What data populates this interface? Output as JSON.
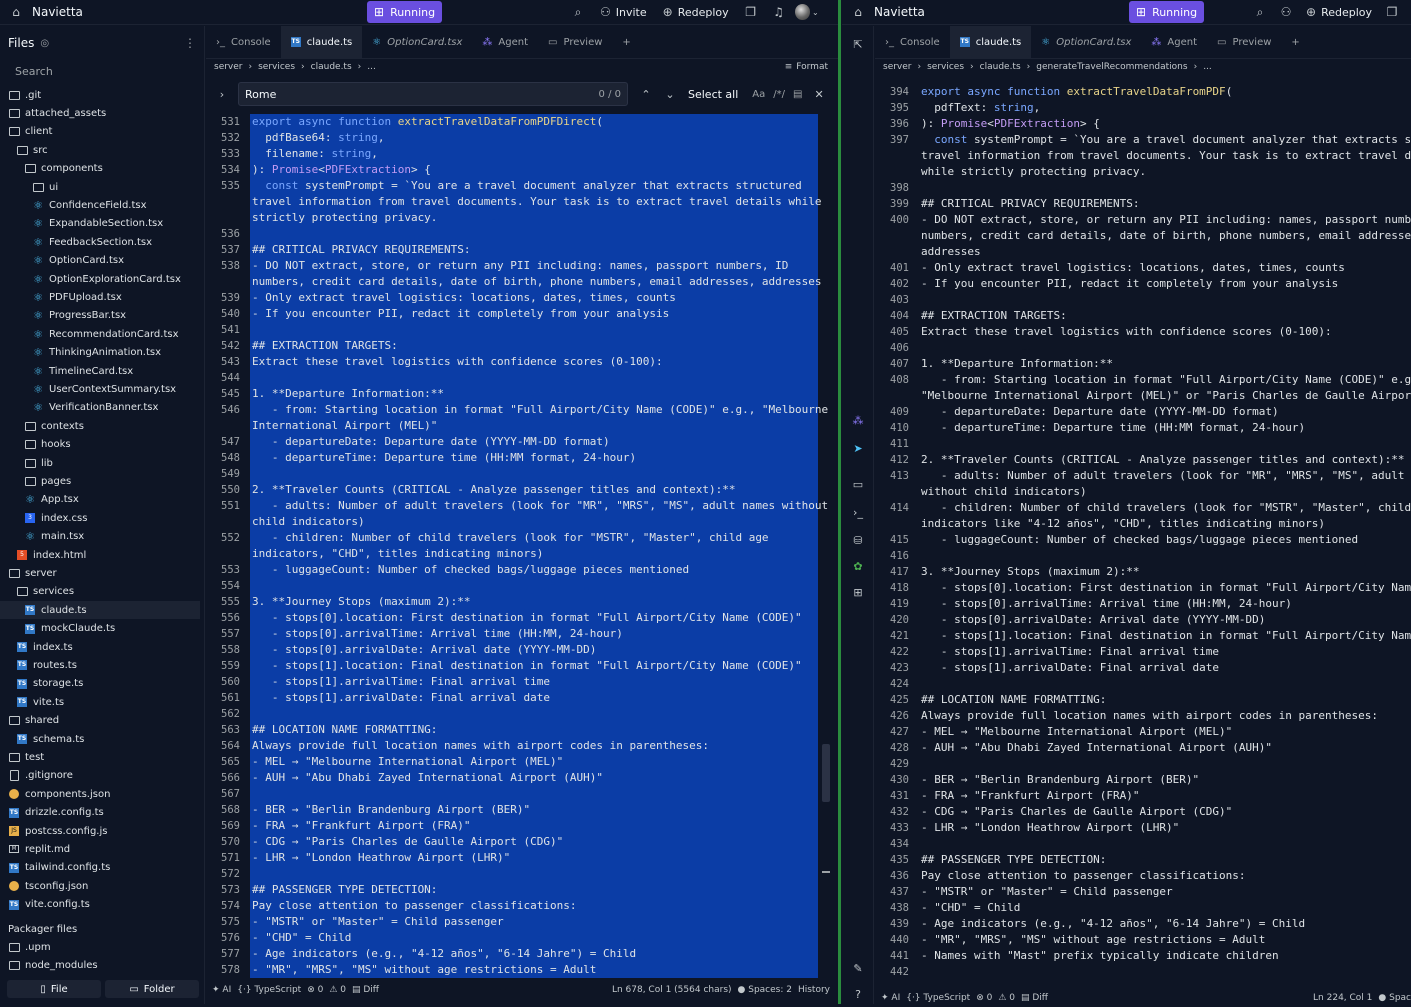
{
  "left_topbar": {
    "app_name": "Navietta",
    "running": "Running",
    "invite": "Invite",
    "redeploy": "Redeploy"
  },
  "right_topbar": {
    "app_name": "Navietta",
    "running": "Running",
    "redeploy": "Redeploy"
  },
  "sidebar": {
    "title": "Files",
    "search_placeholder": "Search",
    "tree": [
      {
        "name": ".git",
        "icon": "folder",
        "level": 0
      },
      {
        "name": "attached_assets",
        "icon": "folder",
        "level": 0
      },
      {
        "name": "client",
        "icon": "folder-open",
        "level": 0
      },
      {
        "name": "src",
        "icon": "folder-open",
        "level": 1
      },
      {
        "name": "components",
        "icon": "folder-open",
        "level": 2
      },
      {
        "name": "ui",
        "icon": "folder",
        "level": 3
      },
      {
        "name": "ConfidenceField.tsx",
        "icon": "tsx",
        "level": 3
      },
      {
        "name": "ExpandableSection.tsx",
        "icon": "tsx",
        "level": 3
      },
      {
        "name": "FeedbackSection.tsx",
        "icon": "tsx",
        "level": 3
      },
      {
        "name": "OptionCard.tsx",
        "icon": "tsx",
        "level": 3
      },
      {
        "name": "OptionExplorationCard.tsx",
        "icon": "tsx",
        "level": 3
      },
      {
        "name": "PDFUpload.tsx",
        "icon": "tsx",
        "level": 3
      },
      {
        "name": "ProgressBar.tsx",
        "icon": "tsx",
        "level": 3
      },
      {
        "name": "RecommendationCard.tsx",
        "icon": "tsx",
        "level": 3
      },
      {
        "name": "ThinkingAnimation.tsx",
        "icon": "tsx",
        "level": 3
      },
      {
        "name": "TimelineCard.tsx",
        "icon": "tsx",
        "level": 3
      },
      {
        "name": "UserContextSummary.tsx",
        "icon": "tsx",
        "level": 3
      },
      {
        "name": "VerificationBanner.tsx",
        "icon": "tsx",
        "level": 3
      },
      {
        "name": "contexts",
        "icon": "folder",
        "level": 2
      },
      {
        "name": "hooks",
        "icon": "folder",
        "level": 2
      },
      {
        "name": "lib",
        "icon": "folder",
        "level": 2
      },
      {
        "name": "pages",
        "icon": "folder",
        "level": 2
      },
      {
        "name": "App.tsx",
        "icon": "tsx",
        "level": 2
      },
      {
        "name": "index.css",
        "icon": "css",
        "level": 2
      },
      {
        "name": "main.tsx",
        "icon": "tsx",
        "level": 2
      },
      {
        "name": "index.html",
        "icon": "html",
        "level": 1
      },
      {
        "name": "server",
        "icon": "folder-open",
        "level": 0
      },
      {
        "name": "services",
        "icon": "folder-open",
        "level": 1
      },
      {
        "name": "claude.ts",
        "icon": "ts",
        "level": 2,
        "selected": true
      },
      {
        "name": "mockClaude.ts",
        "icon": "ts",
        "level": 2
      },
      {
        "name": "index.ts",
        "icon": "ts",
        "level": 1
      },
      {
        "name": "routes.ts",
        "icon": "ts",
        "level": 1
      },
      {
        "name": "storage.ts",
        "icon": "ts",
        "level": 1
      },
      {
        "name": "vite.ts",
        "icon": "ts",
        "level": 1
      },
      {
        "name": "shared",
        "icon": "folder-open",
        "level": 0
      },
      {
        "name": "schema.ts",
        "icon": "ts",
        "level": 1
      },
      {
        "name": "test",
        "icon": "folder",
        "level": 0
      },
      {
        "name": ".gitignore",
        "icon": "file",
        "level": 0
      },
      {
        "name": "components.json",
        "icon": "json",
        "level": 0
      },
      {
        "name": "drizzle.config.ts",
        "icon": "ts",
        "level": 0
      },
      {
        "name": "postcss.config.js",
        "icon": "js",
        "level": 0
      },
      {
        "name": "replit.md",
        "icon": "md",
        "level": 0
      },
      {
        "name": "tailwind.config.ts",
        "icon": "ts",
        "level": 0
      },
      {
        "name": "tsconfig.json",
        "icon": "json",
        "level": 0
      },
      {
        "name": "vite.config.ts",
        "icon": "ts",
        "level": 0
      }
    ],
    "packager_title": "Packager files",
    "packager": [
      {
        "name": ".upm",
        "icon": "folder"
      },
      {
        "name": "node_modules",
        "icon": "folder"
      }
    ],
    "file_button": "File",
    "folder_button": "Folder"
  },
  "left_editor": {
    "tabs": [
      {
        "label": "Console",
        "icon": ">_",
        "active": false
      },
      {
        "label": "claude.ts",
        "icon": "ts",
        "active": true
      },
      {
        "label": "OptionCard.tsx",
        "icon": "tsx",
        "active": false
      },
      {
        "label": "Agent",
        "icon": "agent",
        "active": false
      },
      {
        "label": "Preview",
        "icon": "preview",
        "active": false
      }
    ],
    "breadcrumb": [
      "server",
      "services",
      "claude.ts",
      "..."
    ],
    "format_label": "Format",
    "find": {
      "query": "Rome",
      "count": "0 / 0",
      "select_all": "Select all",
      "case": "Aa",
      "regex": "/*/"
    },
    "status": {
      "ai": "AI",
      "language": "TypeScript",
      "errors": "0",
      "warnings": "0",
      "diff": "Diff",
      "position": "Ln 678, Col 1 (5564 chars)",
      "spaces": "Spaces: 2",
      "history": "History"
    }
  },
  "right_editor": {
    "tabs": [
      {
        "label": "Console",
        "icon": ">_",
        "active": false
      },
      {
        "label": "claude.ts",
        "icon": "ts",
        "active": true
      },
      {
        "label": "OptionCard.tsx",
        "icon": "tsx",
        "active": false
      },
      {
        "label": "Agent",
        "icon": "agent",
        "active": false
      },
      {
        "label": "Preview",
        "icon": "preview",
        "active": false
      }
    ],
    "breadcrumb": [
      "server",
      "services",
      "claude.ts",
      "generateTravelRecommendations",
      "..."
    ],
    "status": {
      "ai": "AI",
      "language": "TypeScript",
      "errors": "0",
      "warnings": "0",
      "diff": "Diff",
      "position": "Ln 224, Col 1",
      "spaces": "Spac"
    }
  },
  "left_code": [
    {
      "n": [
        "531"
      ],
      "t": "export async function extractTravelDataFromPDFDirect("
    },
    {
      "n": [
        "532"
      ],
      "t": "  pdfBase64: string,"
    },
    {
      "n": [
        "533"
      ],
      "t": "  filename: string,"
    },
    {
      "n": [
        "534"
      ],
      "t": "): Promise<PDFExtraction> {"
    },
    {
      "n": [
        "535"
      ],
      "t": "  const systemPrompt = `You are a travel document analyzer that extracts structured\ntravel information from travel documents. Your task is to extract travel details while\nstrictly protecting privacy."
    },
    {
      "n": [
        "536"
      ],
      "t": ""
    },
    {
      "n": [
        "537"
      ],
      "t": "## CRITICAL PRIVACY REQUIREMENTS:"
    },
    {
      "n": [
        "538"
      ],
      "t": "- DO NOT extract, store, or return any PII including: names, passport numbers, ID\nnumbers, credit card details, date of birth, phone numbers, email addresses, addresses"
    },
    {
      "n": [
        "539"
      ],
      "t": "- Only extract travel logistics: locations, dates, times, counts"
    },
    {
      "n": [
        "540"
      ],
      "t": "- If you encounter PII, redact it completely from your analysis"
    },
    {
      "n": [
        "541"
      ],
      "t": ""
    },
    {
      "n": [
        "542"
      ],
      "t": "## EXTRACTION TARGETS:"
    },
    {
      "n": [
        "543"
      ],
      "t": "Extract these travel logistics with confidence scores (0-100):"
    },
    {
      "n": [
        "544"
      ],
      "t": ""
    },
    {
      "n": [
        "545"
      ],
      "t": "1. **Departure Information:**"
    },
    {
      "n": [
        "546"
      ],
      "t": "   - from: Starting location in format \"Full Airport/City Name (CODE)\" e.g., \"Melbourne\nInternational Airport (MEL)\""
    },
    {
      "n": [
        "547"
      ],
      "t": "   - departureDate: Departure date (YYYY-MM-DD format)"
    },
    {
      "n": [
        "548"
      ],
      "t": "   - departureTime: Departure time (HH:MM format, 24-hour)"
    },
    {
      "n": [
        "549"
      ],
      "t": ""
    },
    {
      "n": [
        "550"
      ],
      "t": "2. **Traveler Counts (CRITICAL - Analyze passenger titles and context):**"
    },
    {
      "n": [
        "551"
      ],
      "t": "   - adults: Number of adult travelers (look for \"MR\", \"MRS\", \"MS\", adult names without\nchild indicators)"
    },
    {
      "n": [
        "552"
      ],
      "t": "   - children: Number of child travelers (look for \"MSTR\", \"Master\", child age\nindicators, \"CHD\", titles indicating minors)"
    },
    {
      "n": [
        "553"
      ],
      "t": "   - luggageCount: Number of checked bags/luggage pieces mentioned"
    },
    {
      "n": [
        "554"
      ],
      "t": ""
    },
    {
      "n": [
        "555"
      ],
      "t": "3. **Journey Stops (maximum 2):**"
    },
    {
      "n": [
        "556"
      ],
      "t": "   - stops[0].location: First destination in format \"Full Airport/City Name (CODE)\""
    },
    {
      "n": [
        "557"
      ],
      "t": "   - stops[0].arrivalTime: Arrival time (HH:MM, 24-hour)"
    },
    {
      "n": [
        "558"
      ],
      "t": "   - stops[0].arrivalDate: Arrival date (YYYY-MM-DD)"
    },
    {
      "n": [
        "559"
      ],
      "t": "   - stops[1].location: Final destination in format \"Full Airport/City Name (CODE)\""
    },
    {
      "n": [
        "560"
      ],
      "t": "   - stops[1].arrivalTime: Final arrival time"
    },
    {
      "n": [
        "561"
      ],
      "t": "   - stops[1].arrivalDate: Final arrival date"
    },
    {
      "n": [
        "562"
      ],
      "t": ""
    },
    {
      "n": [
        "563"
      ],
      "t": "## LOCATION NAME FORMATTING:"
    },
    {
      "n": [
        "564"
      ],
      "t": "Always provide full location names with airport codes in parentheses:"
    },
    {
      "n": [
        "565"
      ],
      "t": "- MEL → \"Melbourne International Airport (MEL)\""
    },
    {
      "n": [
        "566"
      ],
      "t": "- AUH → \"Abu Dhabi Zayed International Airport (AUH)\""
    },
    {
      "n": [
        "567"
      ],
      "t": ""
    },
    {
      "n": [
        "568"
      ],
      "t": "- BER → \"Berlin Brandenburg Airport (BER)\""
    },
    {
      "n": [
        "569"
      ],
      "t": "- FRA → \"Frankfurt Airport (FRA)\""
    },
    {
      "n": [
        "570"
      ],
      "t": "- CDG → \"Paris Charles de Gaulle Airport (CDG)\""
    },
    {
      "n": [
        "571"
      ],
      "t": "- LHR → \"London Heathrow Airport (LHR)\""
    },
    {
      "n": [
        "572"
      ],
      "t": ""
    },
    {
      "n": [
        "573"
      ],
      "t": "## PASSENGER TYPE DETECTION:"
    },
    {
      "n": [
        "574"
      ],
      "t": "Pay close attention to passenger classifications:"
    },
    {
      "n": [
        "575"
      ],
      "t": "- \"MSTR\" or \"Master\" = Child passenger"
    },
    {
      "n": [
        "576"
      ],
      "t": "- \"CHD\" = Child"
    },
    {
      "n": [
        "577"
      ],
      "t": "- Age indicators (e.g., \"4-12 años\", \"6-14 Jahre\") = Child"
    },
    {
      "n": [
        "578"
      ],
      "t": "- \"MR\", \"MRS\", \"MS\" without age restrictions = Adult"
    }
  ],
  "right_code": [
    {
      "n": [
        "394"
      ],
      "t": "export async function extractTravelDataFromPDF("
    },
    {
      "n": [
        "395"
      ],
      "t": "  pdfText: string,"
    },
    {
      "n": [
        "396"
      ],
      "t": "): Promise<PDFExtraction> {"
    },
    {
      "n": [
        "397"
      ],
      "t": "  const systemPrompt = `You are a travel document analyzer that extracts str\ntravel information from travel documents. Your task is to extract travel det\nwhile strictly protecting privacy."
    },
    {
      "n": [
        "398"
      ],
      "t": ""
    },
    {
      "n": [
        "399"
      ],
      "t": "## CRITICAL PRIVACY REQUIREMENTS:"
    },
    {
      "n": [
        "400"
      ],
      "t": "- DO NOT extract, store, or return any PII including: names, passport number\nnumbers, credit card details, date of birth, phone numbers, email addresses,\naddresses"
    },
    {
      "n": [
        "401"
      ],
      "t": "- Only extract travel logistics: locations, dates, times, counts"
    },
    {
      "n": [
        "402"
      ],
      "t": "- If you encounter PII, redact it completely from your analysis"
    },
    {
      "n": [
        "403"
      ],
      "t": ""
    },
    {
      "n": [
        "404"
      ],
      "t": "## EXTRACTION TARGETS:"
    },
    {
      "n": [
        "405"
      ],
      "t": "Extract these travel logistics with confidence scores (0-100):"
    },
    {
      "n": [
        "406"
      ],
      "t": ""
    },
    {
      "n": [
        "407"
      ],
      "t": "1. **Departure Information:**"
    },
    {
      "n": [
        "408"
      ],
      "t": "   - from: Starting location in format \"Full Airport/City Name (CODE)\" e.g.,\n\"Melbourne International Airport (MEL)\" or \"Paris Charles de Gaulle Airport"
    },
    {
      "n": [
        "409"
      ],
      "t": "   - departureDate: Departure date (YYYY-MM-DD format)"
    },
    {
      "n": [
        "410"
      ],
      "t": "   - departureTime: Departure time (HH:MM format, 24-hour)"
    },
    {
      "n": [
        "411"
      ],
      "t": ""
    },
    {
      "n": [
        "412"
      ],
      "t": "2. **Traveler Counts (CRITICAL - Analyze passenger titles and context):**"
    },
    {
      "n": [
        "413"
      ],
      "t": "   - adults: Number of adult travelers (look for \"MR\", \"MRS\", \"MS\", adult na\nwithout child indicators)"
    },
    {
      "n": [
        "414"
      ],
      "t": "   - children: Number of child travelers (look for \"MSTR\", \"Master\", child a\nindicators like \"4-12 años\", \"CHD\", titles indicating minors)"
    },
    {
      "n": [
        "415"
      ],
      "t": "   - luggageCount: Number of checked bags/luggage pieces mentioned"
    },
    {
      "n": [
        "416"
      ],
      "t": ""
    },
    {
      "n": [
        "417"
      ],
      "t": "3. **Journey Stops (maximum 2):**"
    },
    {
      "n": [
        "418"
      ],
      "t": "   - stops[0].location: First destination in format \"Full Airport/City Name"
    },
    {
      "n": [
        "419"
      ],
      "t": "   - stops[0].arrivalTime: Arrival time (HH:MM, 24-hour)"
    },
    {
      "n": [
        "420"
      ],
      "t": "   - stops[0].arrivalDate: Arrival date (YYYY-MM-DD)"
    },
    {
      "n": [
        "421"
      ],
      "t": "   - stops[1].location: Final destination in format \"Full Airport/City Name"
    },
    {
      "n": [
        "422"
      ],
      "t": "   - stops[1].arrivalTime: Final arrival time"
    },
    {
      "n": [
        "423"
      ],
      "t": "   - stops[1].arrivalDate: Final arrival date"
    },
    {
      "n": [
        "424"
      ],
      "t": ""
    },
    {
      "n": [
        "425"
      ],
      "t": "## LOCATION NAME FORMATTING:"
    },
    {
      "n": [
        "426"
      ],
      "t": "Always provide full location names with airport codes in parentheses:"
    },
    {
      "n": [
        "427"
      ],
      "t": "- MEL → \"Melbourne International Airport (MEL)\""
    },
    {
      "n": [
        "428"
      ],
      "t": "- AUH → \"Abu Dhabi Zayed International Airport (AUH)\""
    },
    {
      "n": [
        "429"
      ],
      "t": ""
    },
    {
      "n": [
        "430"
      ],
      "t": "- BER → \"Berlin Brandenburg Airport (BER)\""
    },
    {
      "n": [
        "431"
      ],
      "t": "- FRA → \"Frankfurt Airport (FRA)\""
    },
    {
      "n": [
        "432"
      ],
      "t": "- CDG → \"Paris Charles de Gaulle Airport (CDG)\""
    },
    {
      "n": [
        "433"
      ],
      "t": "- LHR → \"London Heathrow Airport (LHR)\""
    },
    {
      "n": [
        "434"
      ],
      "t": ""
    },
    {
      "n": [
        "435"
      ],
      "t": "## PASSENGER TYPE DETECTION:"
    },
    {
      "n": [
        "436"
      ],
      "t": "Pay close attention to passenger classifications:"
    },
    {
      "n": [
        "437"
      ],
      "t": "- \"MSTR\" or \"Master\" = Child passenger"
    },
    {
      "n": [
        "438"
      ],
      "t": "- \"CHD\" = Child"
    },
    {
      "n": [
        "439"
      ],
      "t": "- Age indicators (e.g., \"4-12 años\", \"6-14 Jahre\") = Child"
    },
    {
      "n": [
        "440"
      ],
      "t": "- \"MR\", \"MRS\", \"MS\" without age restrictions = Adult"
    },
    {
      "n": [
        "441"
      ],
      "t": "- Names with \"Mast\" prefix typically indicate children"
    },
    {
      "n": [
        "442"
      ],
      "t": ""
    }
  ],
  "colors": {
    "accent": "#6a4fe0",
    "selection": "#0b3da6",
    "background": "#0e1525",
    "panel": "#1c2333",
    "divider": "#2a8c3e"
  }
}
